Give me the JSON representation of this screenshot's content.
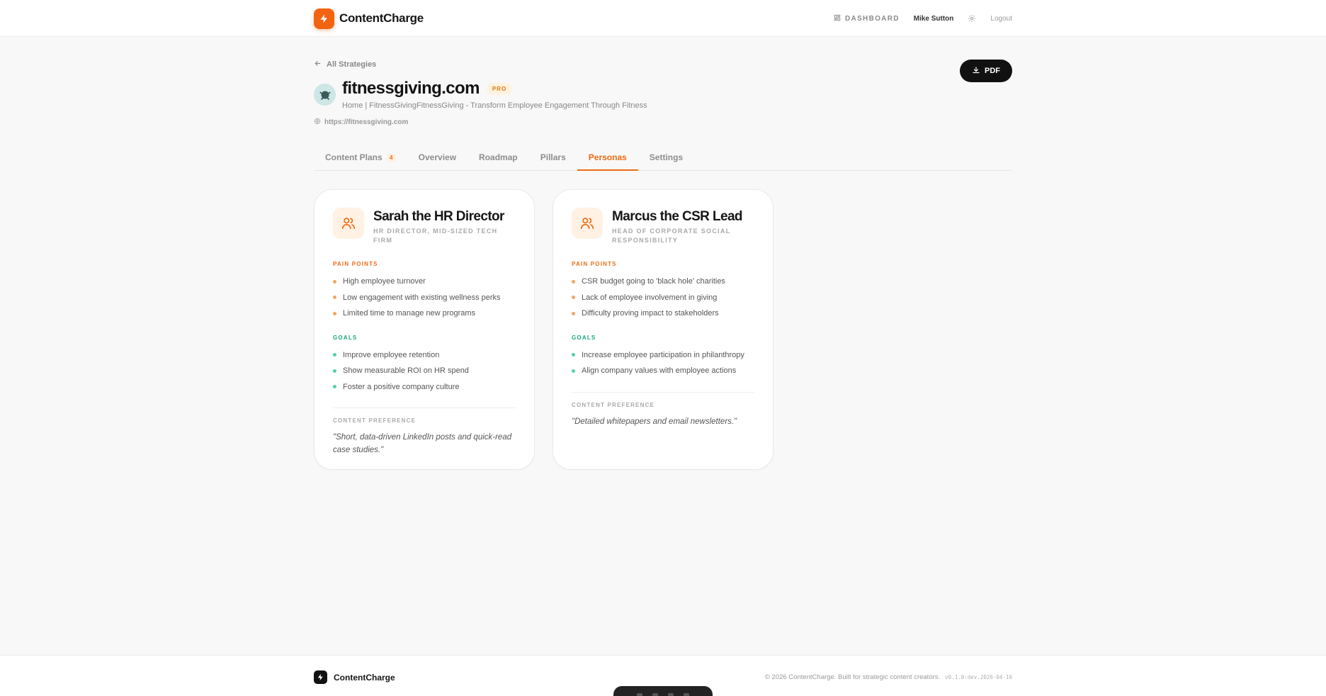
{
  "header": {
    "brand": "ContentCharge",
    "dashboard_label": "DASHBOARD",
    "user_name": "Mike Sutton",
    "logout_label": "Logout"
  },
  "back_link": "All Strategies",
  "strategy": {
    "title": "fitnessgiving.com",
    "badge": "PRO",
    "subtitle": "Home | FitnessGivingFitnessGiving - Transform Employee Engagement Through Fitness",
    "url": "https://fitnessgiving.com"
  },
  "pdf_button": "PDF",
  "tabs": [
    {
      "label": "Content Plans",
      "count": "4"
    },
    {
      "label": "Overview"
    },
    {
      "label": "Roadmap"
    },
    {
      "label": "Pillars"
    },
    {
      "label": "Personas",
      "active": true
    },
    {
      "label": "Settings"
    }
  ],
  "labels": {
    "pain_points": "PAIN POINTS",
    "goals": "GOALS",
    "content_preference": "CONTENT PREFERENCE"
  },
  "personas": [
    {
      "name": "Sarah the HR Director",
      "role": "HR DIRECTOR, MID-SIZED TECH FIRM",
      "pain_points": [
        "High employee turnover",
        "Low engagement with existing wellness perks",
        "Limited time to manage new programs"
      ],
      "goals": [
        "Improve employee retention",
        "Show measurable ROI on HR spend",
        "Foster a positive company culture"
      ],
      "content_preference": "\"Short, data-driven LinkedIn posts and quick-read case studies.\""
    },
    {
      "name": "Marcus the CSR Lead",
      "role": "HEAD OF CORPORATE SOCIAL RESPONSIBILITY",
      "pain_points": [
        "CSR budget going to 'black hole' charities",
        "Lack of employee involvement in giving",
        "Difficulty proving impact to stakeholders"
      ],
      "goals": [
        "Increase employee participation in philanthropy",
        "Align company values with employee actions"
      ],
      "content_preference": "\"Detailed whitepapers and email newsletters.\""
    }
  ],
  "footer": {
    "brand": "ContentCharge",
    "copyright": "© 2026 ContentCharge. Built for strategic content creators.",
    "version": "v0.1.0:dev.2026-04-16"
  },
  "colors": {
    "accent": "#f06a12",
    "goal": "#17a973",
    "dark": "#111111"
  },
  "icons": [
    "bolt-icon",
    "dashboard-icon",
    "gear-icon",
    "arrow-left-icon",
    "globe-icon",
    "download-icon",
    "users-icon"
  ]
}
